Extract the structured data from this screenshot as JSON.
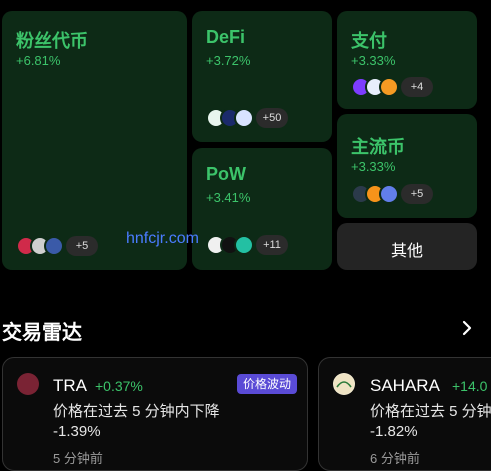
{
  "heatmap": {
    "fan": {
      "name": "粉丝代币",
      "change": "+6.81%",
      "more": "+5"
    },
    "defi": {
      "name": "DeFi",
      "change": "+3.72%",
      "more": "+50"
    },
    "pay": {
      "name": "支付",
      "change": "+3.33%",
      "more": "+4"
    },
    "mainstream": {
      "name": "主流币",
      "change": "+3.33%",
      "more": "+5"
    },
    "pow": {
      "name": "PoW",
      "change": "+3.41%",
      "more": "+11"
    },
    "other": {
      "name": "其他"
    }
  },
  "watermark": "hnfcjr.com",
  "radar": {
    "title": "交易雷达",
    "cards": [
      {
        "symbol": "TRA",
        "change": "+0.37%",
        "tag": "价格波动",
        "desc_line1": "价格在过去 5 分钟内下降",
        "desc_line2": "-1.39%",
        "time": "5 分钟前"
      },
      {
        "symbol": "SAHARA",
        "change": "+14.0",
        "desc_line1": "价格在过去 5 分钟",
        "desc_line2": "-1.82%",
        "time": "6 分钟前"
      }
    ]
  }
}
